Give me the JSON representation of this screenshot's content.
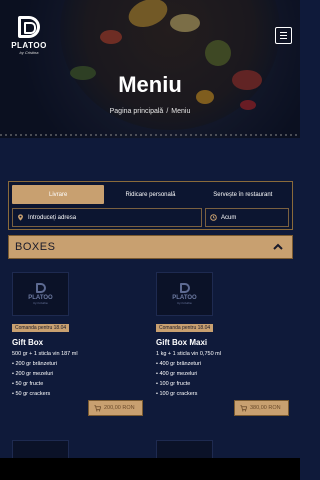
{
  "header": {
    "logo_name": "PLATOO",
    "logo_tagline": "by Cristina",
    "title": "Meniu",
    "breadcrumb": {
      "home": "Pagina principală",
      "separator": "/",
      "current": "Meniu"
    }
  },
  "order": {
    "tabs": [
      {
        "label": "Livrare",
        "active": true
      },
      {
        "label": "Ridicare personală",
        "active": false
      },
      {
        "label": "Servește în restaurant",
        "active": false
      }
    ],
    "address_value": "Introduceți adresa",
    "time_value": "Acum"
  },
  "section": {
    "title": "BOXES"
  },
  "products": [
    {
      "badge": "Comanda pentru 18.04",
      "name": "Gift Box",
      "desc": "500 gr + 1 sticla vin 187 ml",
      "items": [
        "• 200 gr brânzeturi",
        "• 200 gr mezeluri",
        "• 50 gr fructe",
        "• 50 gr crackers"
      ],
      "price": "200,00 RON"
    },
    {
      "badge": "Comanda pentru 18.04",
      "name": "Gift Box Maxi",
      "desc": "1 kg + 1 sticla vin 0,750 ml",
      "items": [
        "• 400 gr brânzeturi",
        "• 400 gr mezeluri",
        "• 100 gr fructe",
        "• 100 gr crackers"
      ],
      "price": "380,00 RON"
    }
  ],
  "colors": {
    "background": "#0f1a3a",
    "accent": "#c8a070",
    "border": "#8a6a3a"
  }
}
